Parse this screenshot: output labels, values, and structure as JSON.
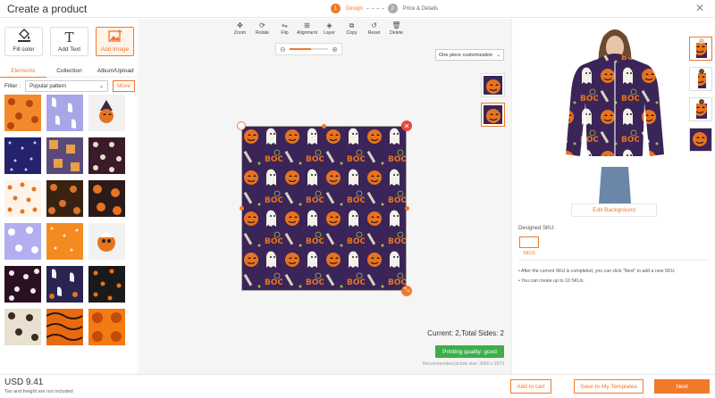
{
  "header": {
    "title": "Create a product",
    "steps": [
      {
        "num": "1",
        "label": "Design"
      },
      {
        "num": "2",
        "label": "Price & Details"
      }
    ],
    "close_icon": "close-icon"
  },
  "tools": [
    {
      "label": "Fill color",
      "icon": "paint-bucket-icon"
    },
    {
      "label": "Add Text",
      "icon": "text-icon"
    },
    {
      "label": "Add Image",
      "icon": "image-icon"
    }
  ],
  "subtabs": [
    "Elements",
    "Collection",
    "Album/Upload"
  ],
  "filter": {
    "label": "Filter :",
    "value": "Popular pattern",
    "more": "More"
  },
  "toolbar": [
    "Zoom",
    "Rotate",
    "Flip",
    "Alignment",
    "Layer",
    "Copy",
    "Reset",
    "Delete"
  ],
  "canvas": {
    "customization": "One piece customization",
    "sides_text": "Current: 2,Total Sides: 2",
    "quality": "Printing quality: good",
    "recommended": "Recommended picture size: 3660 x 2673"
  },
  "preview": {
    "edit_background": "Edit Background",
    "designed_sku_label": "Designed SKU:",
    "sku_name": "SKU1",
    "tips": [
      "After the current SKU is completed, you can click \"Next\" to add a new SKU.",
      "You can create up to 10 SKUs."
    ]
  },
  "footer": {
    "price": "USD 9.41",
    "price_note": "Tax and freight are not included",
    "add_to_cart": "Add to cart",
    "save_templates": "Save to My Templates",
    "next": "Next"
  },
  "colors": {
    "accent": "#f07a2a",
    "success": "#3cae4a",
    "danger": "#e8473a"
  }
}
